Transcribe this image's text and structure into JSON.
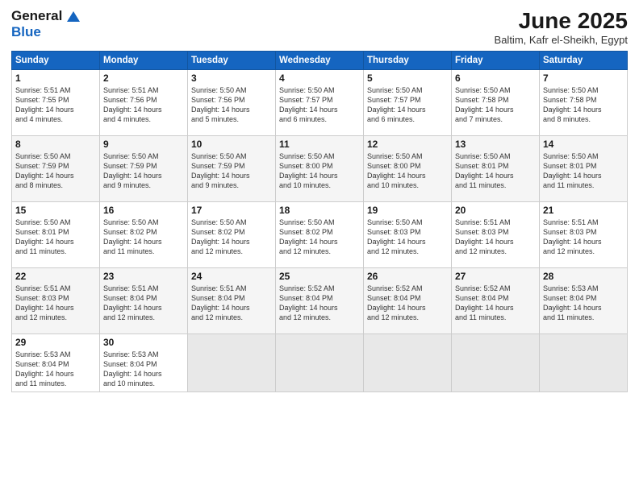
{
  "header": {
    "logo_general": "General",
    "logo_blue": "Blue",
    "month": "June 2025",
    "location": "Baltim, Kafr el-Sheikh, Egypt"
  },
  "days_of_week": [
    "Sunday",
    "Monday",
    "Tuesday",
    "Wednesday",
    "Thursday",
    "Friday",
    "Saturday"
  ],
  "weeks": [
    [
      {
        "day": 1,
        "lines": [
          "Sunrise: 5:51 AM",
          "Sunset: 7:55 PM",
          "Daylight: 14 hours",
          "and 4 minutes."
        ]
      },
      {
        "day": 2,
        "lines": [
          "Sunrise: 5:51 AM",
          "Sunset: 7:56 PM",
          "Daylight: 14 hours",
          "and 4 minutes."
        ]
      },
      {
        "day": 3,
        "lines": [
          "Sunrise: 5:50 AM",
          "Sunset: 7:56 PM",
          "Daylight: 14 hours",
          "and 5 minutes."
        ]
      },
      {
        "day": 4,
        "lines": [
          "Sunrise: 5:50 AM",
          "Sunset: 7:57 PM",
          "Daylight: 14 hours",
          "and 6 minutes."
        ]
      },
      {
        "day": 5,
        "lines": [
          "Sunrise: 5:50 AM",
          "Sunset: 7:57 PM",
          "Daylight: 14 hours",
          "and 6 minutes."
        ]
      },
      {
        "day": 6,
        "lines": [
          "Sunrise: 5:50 AM",
          "Sunset: 7:58 PM",
          "Daylight: 14 hours",
          "and 7 minutes."
        ]
      },
      {
        "day": 7,
        "lines": [
          "Sunrise: 5:50 AM",
          "Sunset: 7:58 PM",
          "Daylight: 14 hours",
          "and 8 minutes."
        ]
      }
    ],
    [
      {
        "day": 8,
        "lines": [
          "Sunrise: 5:50 AM",
          "Sunset: 7:59 PM",
          "Daylight: 14 hours",
          "and 8 minutes."
        ]
      },
      {
        "day": 9,
        "lines": [
          "Sunrise: 5:50 AM",
          "Sunset: 7:59 PM",
          "Daylight: 14 hours",
          "and 9 minutes."
        ]
      },
      {
        "day": 10,
        "lines": [
          "Sunrise: 5:50 AM",
          "Sunset: 7:59 PM",
          "Daylight: 14 hours",
          "and 9 minutes."
        ]
      },
      {
        "day": 11,
        "lines": [
          "Sunrise: 5:50 AM",
          "Sunset: 8:00 PM",
          "Daylight: 14 hours",
          "and 10 minutes."
        ]
      },
      {
        "day": 12,
        "lines": [
          "Sunrise: 5:50 AM",
          "Sunset: 8:00 PM",
          "Daylight: 14 hours",
          "and 10 minutes."
        ]
      },
      {
        "day": 13,
        "lines": [
          "Sunrise: 5:50 AM",
          "Sunset: 8:01 PM",
          "Daylight: 14 hours",
          "and 11 minutes."
        ]
      },
      {
        "day": 14,
        "lines": [
          "Sunrise: 5:50 AM",
          "Sunset: 8:01 PM",
          "Daylight: 14 hours",
          "and 11 minutes."
        ]
      }
    ],
    [
      {
        "day": 15,
        "lines": [
          "Sunrise: 5:50 AM",
          "Sunset: 8:01 PM",
          "Daylight: 14 hours",
          "and 11 minutes."
        ]
      },
      {
        "day": 16,
        "lines": [
          "Sunrise: 5:50 AM",
          "Sunset: 8:02 PM",
          "Daylight: 14 hours",
          "and 11 minutes."
        ]
      },
      {
        "day": 17,
        "lines": [
          "Sunrise: 5:50 AM",
          "Sunset: 8:02 PM",
          "Daylight: 14 hours",
          "and 12 minutes."
        ]
      },
      {
        "day": 18,
        "lines": [
          "Sunrise: 5:50 AM",
          "Sunset: 8:02 PM",
          "Daylight: 14 hours",
          "and 12 minutes."
        ]
      },
      {
        "day": 19,
        "lines": [
          "Sunrise: 5:50 AM",
          "Sunset: 8:03 PM",
          "Daylight: 14 hours",
          "and 12 minutes."
        ]
      },
      {
        "day": 20,
        "lines": [
          "Sunrise: 5:51 AM",
          "Sunset: 8:03 PM",
          "Daylight: 14 hours",
          "and 12 minutes."
        ]
      },
      {
        "day": 21,
        "lines": [
          "Sunrise: 5:51 AM",
          "Sunset: 8:03 PM",
          "Daylight: 14 hours",
          "and 12 minutes."
        ]
      }
    ],
    [
      {
        "day": 22,
        "lines": [
          "Sunrise: 5:51 AM",
          "Sunset: 8:03 PM",
          "Daylight: 14 hours",
          "and 12 minutes."
        ]
      },
      {
        "day": 23,
        "lines": [
          "Sunrise: 5:51 AM",
          "Sunset: 8:04 PM",
          "Daylight: 14 hours",
          "and 12 minutes."
        ]
      },
      {
        "day": 24,
        "lines": [
          "Sunrise: 5:51 AM",
          "Sunset: 8:04 PM",
          "Daylight: 14 hours",
          "and 12 minutes."
        ]
      },
      {
        "day": 25,
        "lines": [
          "Sunrise: 5:52 AM",
          "Sunset: 8:04 PM",
          "Daylight: 14 hours",
          "and 12 minutes."
        ]
      },
      {
        "day": 26,
        "lines": [
          "Sunrise: 5:52 AM",
          "Sunset: 8:04 PM",
          "Daylight: 14 hours",
          "and 12 minutes."
        ]
      },
      {
        "day": 27,
        "lines": [
          "Sunrise: 5:52 AM",
          "Sunset: 8:04 PM",
          "Daylight: 14 hours",
          "and 11 minutes."
        ]
      },
      {
        "day": 28,
        "lines": [
          "Sunrise: 5:53 AM",
          "Sunset: 8:04 PM",
          "Daylight: 14 hours",
          "and 11 minutes."
        ]
      }
    ],
    [
      {
        "day": 29,
        "lines": [
          "Sunrise: 5:53 AM",
          "Sunset: 8:04 PM",
          "Daylight: 14 hours",
          "and 11 minutes."
        ]
      },
      {
        "day": 30,
        "lines": [
          "Sunrise: 5:53 AM",
          "Sunset: 8:04 PM",
          "Daylight: 14 hours",
          "and 10 minutes."
        ]
      },
      null,
      null,
      null,
      null,
      null
    ]
  ]
}
